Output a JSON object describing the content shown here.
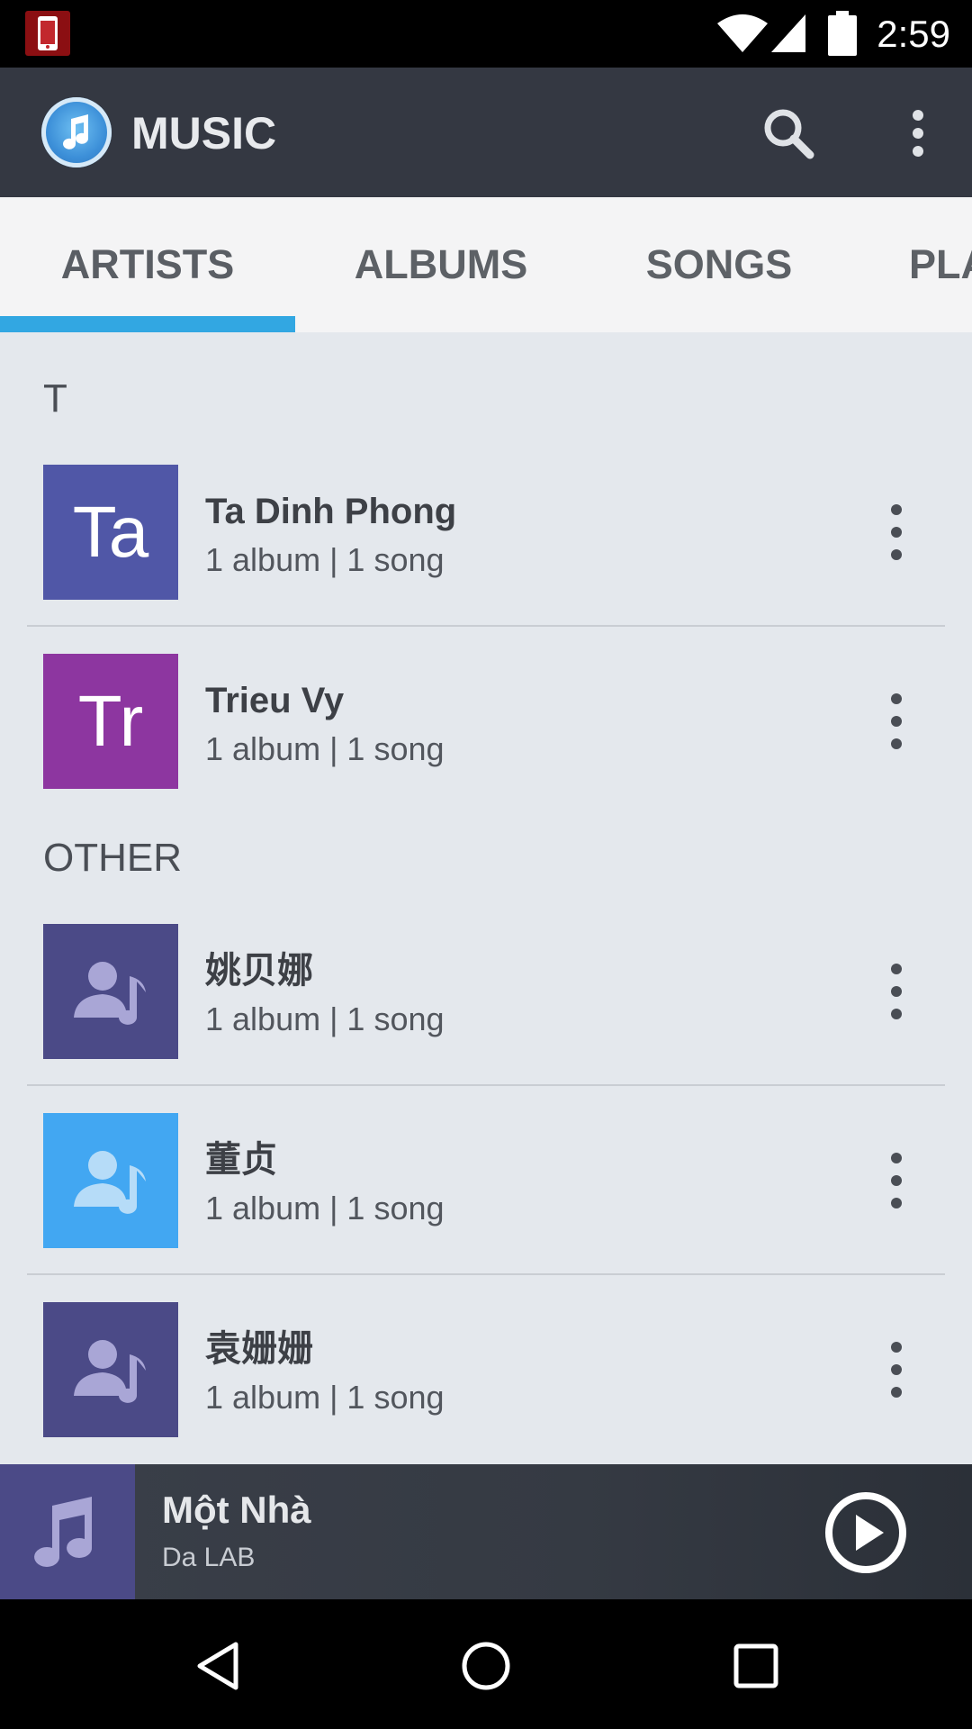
{
  "status_bar": {
    "time": "2:59"
  },
  "app_bar": {
    "title": "MUSIC"
  },
  "tabs": [
    {
      "label": "ARTISTS",
      "selected": true
    },
    {
      "label": "ALBUMS",
      "selected": false
    },
    {
      "label": "SONGS",
      "selected": false
    },
    {
      "label": "PLA",
      "selected": false
    }
  ],
  "sections": [
    {
      "header": "T",
      "artists": [
        {
          "initials": "Ta",
          "name": "Ta Dinh Phong",
          "meta": "1 album | 1 song",
          "avatar_color": "#5057a7"
        },
        {
          "initials": "Tr",
          "name": "Trieu Vy",
          "meta": "1 album | 1 song",
          "avatar_color": "#8d36a0"
        }
      ]
    },
    {
      "header": "OTHER",
      "artists": [
        {
          "initials": "",
          "name": "姚贝娜",
          "meta": "1 album | 1 song",
          "avatar_color": "#4b4a87"
        },
        {
          "initials": "",
          "name": "董贞",
          "meta": "1 album | 1 song",
          "avatar_color": "#42a7f2"
        },
        {
          "initials": "",
          "name": "袁姗姗",
          "meta": "1 album | 1 song",
          "avatar_color": "#4b4a87"
        }
      ]
    }
  ],
  "now_playing": {
    "title": "Một Nhà",
    "artist": "Da LAB"
  },
  "colors": {
    "accent": "#32a7e2",
    "app_bar": "#343842",
    "tab_bg": "#f4f4f5",
    "list_bg": "#e4e8ed"
  }
}
